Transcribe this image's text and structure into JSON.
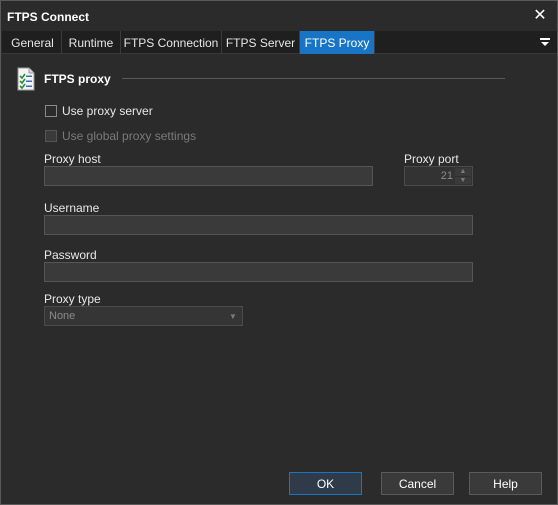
{
  "window": {
    "title": "FTPS Connect"
  },
  "tabs": [
    {
      "label": "General"
    },
    {
      "label": "Runtime"
    },
    {
      "label": "FTPS Connection"
    },
    {
      "label": "FTPS Server"
    },
    {
      "label": "FTPS Proxy"
    }
  ],
  "section": {
    "title": "FTPS proxy",
    "icon": "checklist-icon"
  },
  "options": {
    "use_proxy": {
      "label": "Use proxy server",
      "checked": false
    },
    "use_global": {
      "label": "Use global proxy settings",
      "checked": false,
      "disabled": true
    }
  },
  "fields": {
    "proxy_host": {
      "label": "Proxy host",
      "value": ""
    },
    "proxy_port": {
      "label": "Proxy port",
      "value": "21"
    },
    "username": {
      "label": "Username",
      "value": ""
    },
    "password": {
      "label": "Password",
      "value": ""
    },
    "proxy_type": {
      "label": "Proxy type",
      "value": "None"
    }
  },
  "buttons": {
    "ok": "OK",
    "cancel": "Cancel",
    "help": "Help"
  },
  "colors": {
    "accent": "#1874c4",
    "background": "#2b2b2b"
  }
}
